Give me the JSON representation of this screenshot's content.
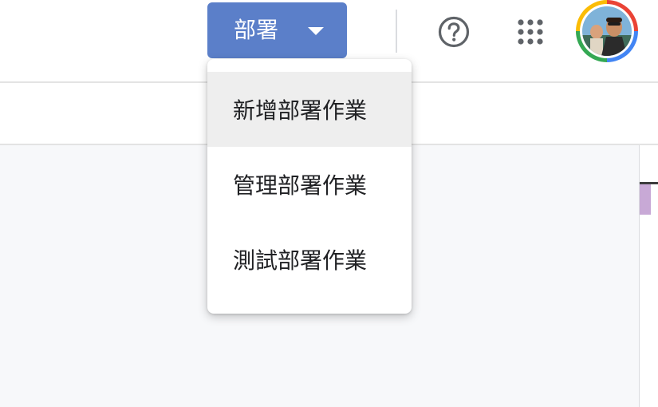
{
  "header": {
    "deploy_button_label": "部署",
    "help_icon": "help-circle-icon",
    "apps_icon": "apps-grid-icon",
    "account_icon": "account-avatar"
  },
  "deploy_menu": {
    "items": [
      {
        "label": "新增部署作業"
      },
      {
        "label": "管理部署作業"
      },
      {
        "label": "測試部署作業"
      }
    ]
  },
  "colors": {
    "deploy_button": "#5b7fc9",
    "menu_hover": "#eeeeee",
    "icon": "#5f6368",
    "content_bg": "#f7f8fa"
  }
}
